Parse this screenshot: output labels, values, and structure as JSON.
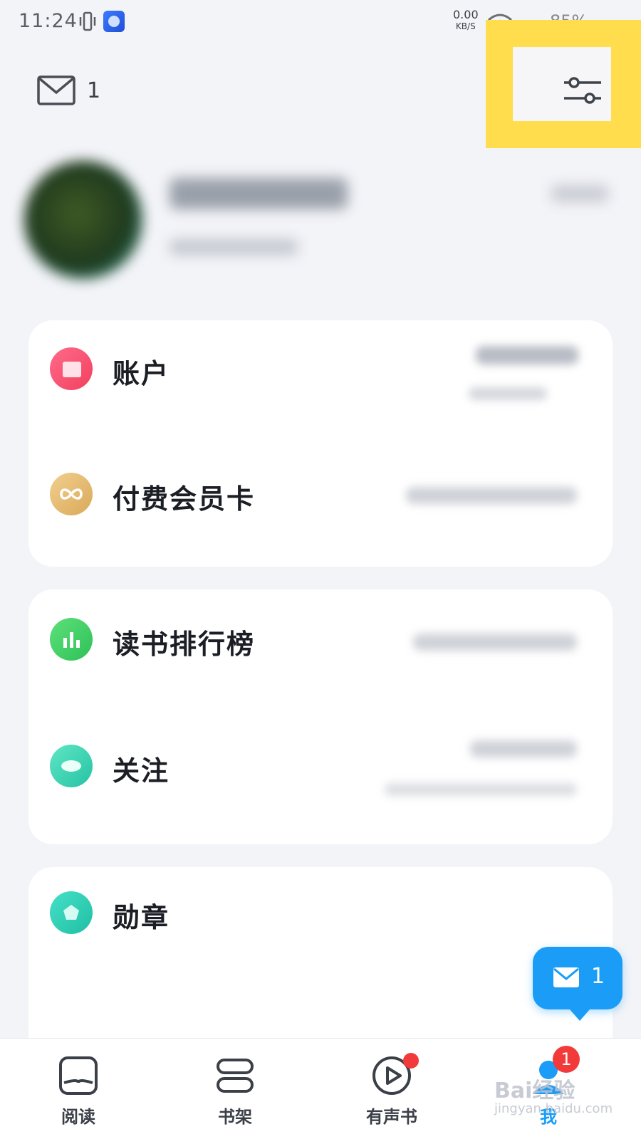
{
  "status_bar": {
    "time": "11:24",
    "net_speed": "0.00",
    "net_unit": "KB/S",
    "battery": "85%"
  },
  "header": {
    "mail_count": "1",
    "settings_icon": "sliders-icon"
  },
  "card1": {
    "rows": [
      {
        "label": "账户",
        "icon": "wallet-icon",
        "color": "#f2405f"
      },
      {
        "label": "付费会员卡",
        "icon": "infinity-icon",
        "color": "#d9a959"
      }
    ]
  },
  "card2": {
    "rows": [
      {
        "label": "读书排行榜",
        "icon": "bar-chart-icon",
        "color": "#2cc157"
      },
      {
        "label": "关注",
        "icon": "eye-icon",
        "color": "#25c3a4"
      }
    ]
  },
  "card3": {
    "rows": [
      {
        "label": "勋章",
        "icon": "medal-icon",
        "color": "#1fbfa3"
      }
    ]
  },
  "floating_message": {
    "count": "1",
    "color": "#1a9cf7"
  },
  "bottom_nav": {
    "items": [
      {
        "label": "阅读",
        "icon": "book-icon"
      },
      {
        "label": "书架",
        "icon": "bookshelf-icon"
      },
      {
        "label": "有声书",
        "icon": "play-circle-icon"
      },
      {
        "label": "我",
        "icon": "profile-icon"
      }
    ],
    "me_badge": "1"
  },
  "watermark": {
    "text": "Bai经验",
    "sub": "jingyan.baidu.com"
  }
}
